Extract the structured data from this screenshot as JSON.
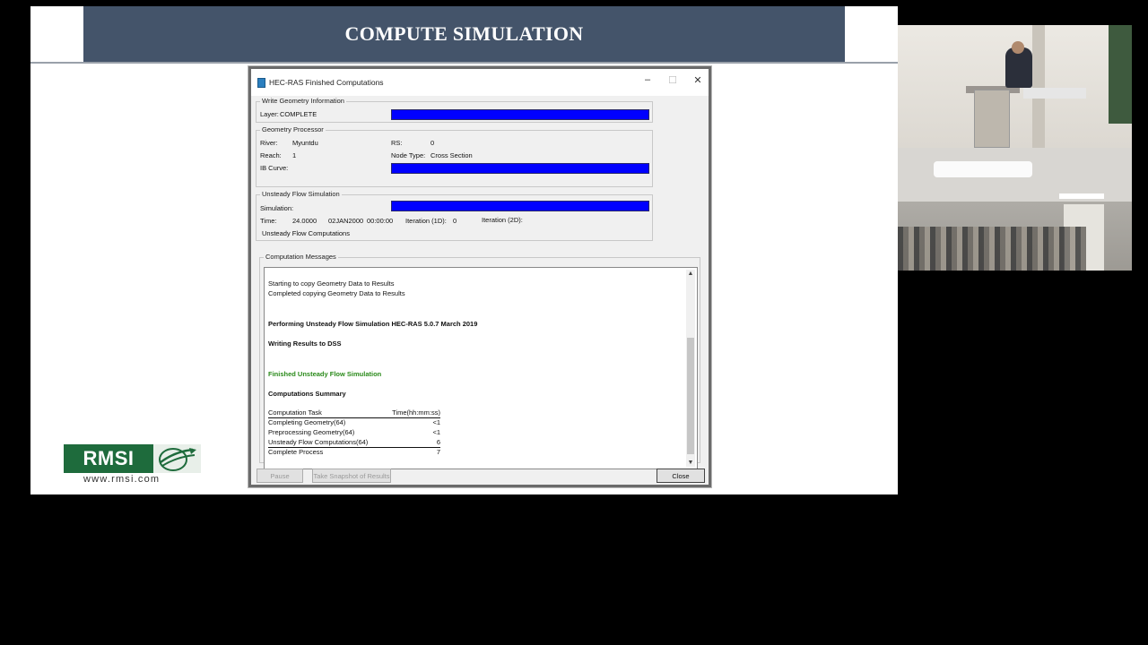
{
  "slide": {
    "title": "COMPUTE SIMULATION",
    "logo_text": "RMSI",
    "logo_url": "www.rmsi.com"
  },
  "dialog": {
    "title": "HEC-RAS Finished Computations",
    "window_buttons": {
      "minimize": "–",
      "maximize": "☐",
      "close": "✕"
    },
    "write_geometry": {
      "group_label": "Write Geometry Information",
      "layer_label": "Layer:",
      "layer_value": "COMPLETE",
      "progress": 1.0
    },
    "geometry_processor": {
      "group_label": "Geometry Processor",
      "river_label": "River:",
      "river_value": "Myuntdu",
      "rs_label": "RS:",
      "rs_value": "0",
      "reach_label": "Reach:",
      "reach_value": "1",
      "node_type_label": "Node Type:",
      "node_type_value": "Cross Section",
      "ib_curve_label": "IB Curve:",
      "progress": 1.0
    },
    "unsteady": {
      "group_label": "Unsteady Flow Simulation",
      "simulation_label": "Simulation:",
      "progress": 1.0,
      "time_label": "Time:",
      "time_value": "24.0000",
      "date_value": "02JAN2000",
      "clock_value": "00:00:00",
      "iter1d_label": "Iteration (1D):",
      "iter1d_value": "0",
      "iter2d_label": "Iteration (2D):",
      "status_text": "Unsteady Flow Computations"
    },
    "messages": {
      "group_label": "Computation Messages",
      "lines": [
        "Starting to copy Geometry Data to Results",
        "Completed copying Geometry Data to Results",
        "Performing Unsteady Flow Simulation  HEC-RAS 5.0.7 March 2019",
        "Writing Results to DSS",
        "Finished Unsteady Flow Simulation",
        "Computations Summary"
      ],
      "summary_header": {
        "task": "Computation Task",
        "time": "Time(hh:mm:ss)"
      },
      "summary_rows": [
        {
          "task": "Completing Geometry(64)",
          "time": "<1"
        },
        {
          "task": "Preprocessing Geometry(64)",
          "time": "<1"
        },
        {
          "task": "Unsteady Flow Computations(64)",
          "time": "6"
        },
        {
          "task": "Complete Process",
          "time": "7"
        }
      ]
    },
    "buttons": {
      "pause": "Pause",
      "snapshot": "Take Snapshot of Results",
      "close": "Close"
    }
  },
  "colors": {
    "title_bar": "#44546a",
    "progress": "#0000ff",
    "success_text": "#2a8a1a",
    "logo_green": "#1e6b3c"
  }
}
